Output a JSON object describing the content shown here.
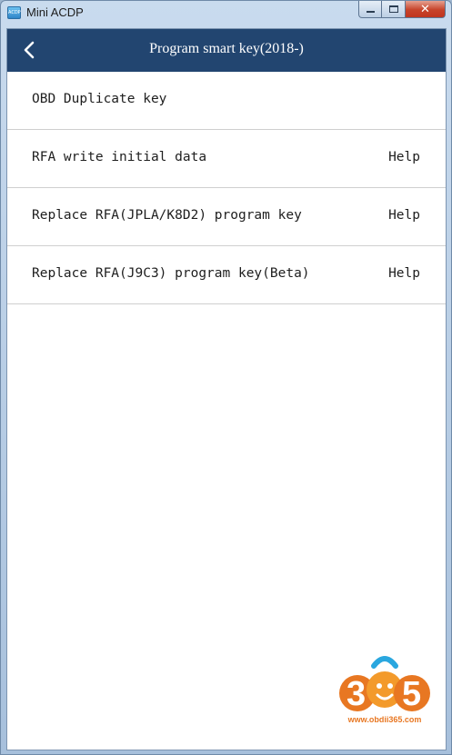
{
  "window": {
    "title": "Mini ACDP",
    "icon_text": "ACDP",
    "buttons": [
      "minimize",
      "maximize",
      "close"
    ]
  },
  "header": {
    "title": "Program smart key(2018-)",
    "back_icon": "chevron-left-icon"
  },
  "menu": {
    "items": [
      {
        "label": "OBD Duplicate key",
        "help": ""
      },
      {
        "label": "RFA write initial data",
        "help": "Help"
      },
      {
        "label": "Replace RFA(JPLA/K8D2) program key",
        "help": "Help"
      },
      {
        "label": "Replace RFA(J9C3) program key(Beta)",
        "help": "Help"
      }
    ]
  },
  "watermark": {
    "digits": [
      "3",
      "6",
      "5"
    ],
    "url": "www.obdii365.com"
  },
  "colors": {
    "header_bg": "#224570",
    "row_divider": "#cfcfcf",
    "watermark_orange": "#e87722",
    "watermark_blue": "#2aa7df"
  }
}
